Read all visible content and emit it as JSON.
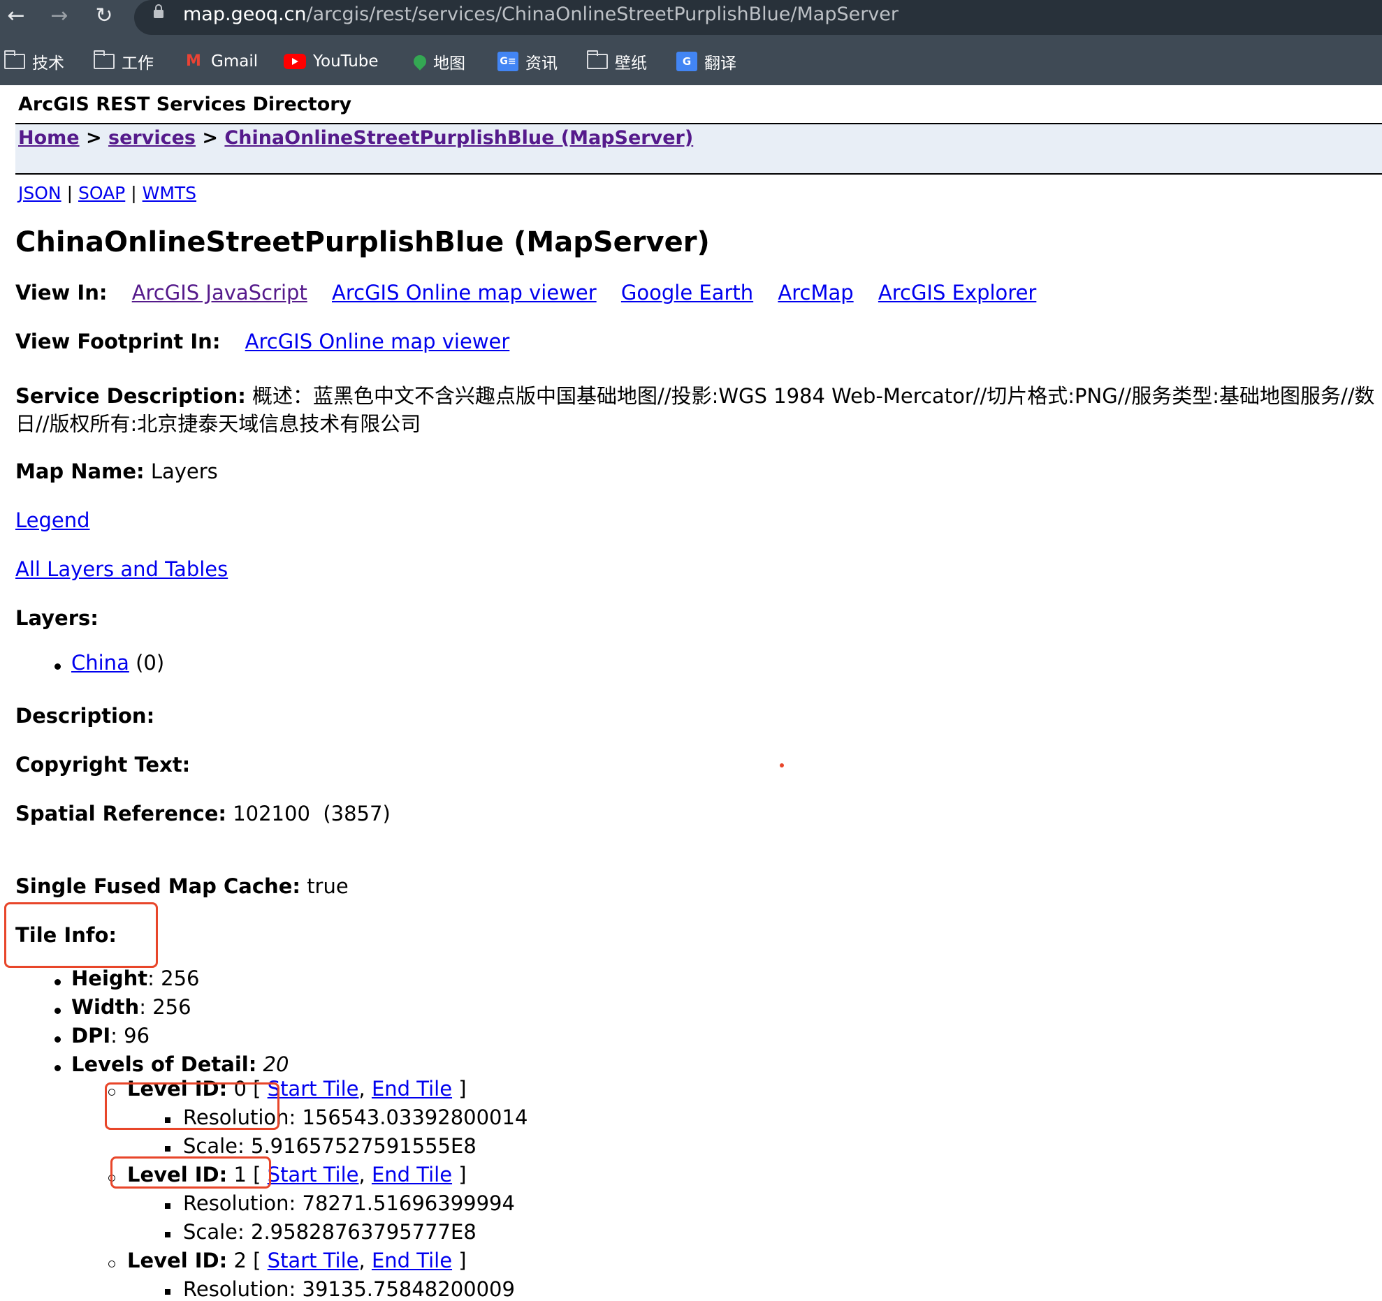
{
  "browser": {
    "url_host": "map.geoq.cn",
    "url_path": "/arcgis/rest/services/ChinaOnlineStreetPurplishBlue/MapServer",
    "bookmarks": [
      "技术",
      "工作",
      "Gmail",
      "YouTube",
      "地图",
      "资讯",
      "壁纸",
      "翻译"
    ]
  },
  "header": {
    "title": "ArcGIS REST Services Directory",
    "breadcrumb": [
      "Home",
      "services",
      "ChinaOnlineStreetPurplishBlue (MapServer)"
    ],
    "breadcrumb_sep": ">",
    "formats": [
      "JSON",
      "SOAP",
      "WMTS"
    ],
    "format_sep": "|"
  },
  "service": {
    "heading": "ChinaOnlineStreetPurplishBlue (MapServer)",
    "view_in_label": "View In:",
    "view_in_links": [
      "ArcGIS JavaScript",
      "ArcGIS Online map viewer",
      "Google Earth",
      "ArcMap",
      "ArcGIS Explorer"
    ],
    "footprint_label": "View Footprint In:",
    "footprint_link": "ArcGIS Online map viewer",
    "desc_label": "Service Description:",
    "desc_line1": "概述：蓝黑色中文不含兴趣点版中国基础地图//投影:WGS 1984 Web-Mercator//切片格式:PNG//服务类型:基础地图服务//数",
    "desc_line2": "日//版权所有:北京捷泰天域信息技术有限公司",
    "map_name_label": "Map Name:",
    "map_name": "Layers",
    "legend_link": "Legend",
    "all_layers_link": "All Layers and Tables",
    "layers_label": "Layers:",
    "layer_name": "China",
    "layer_id": "(0)",
    "description_label": "Description:",
    "copyright_label": "Copyright Text:",
    "spatial_label": "Spatial Reference:",
    "spatial_value": "102100  (3857)",
    "cache_label": "Single Fused Map Cache:",
    "cache_value": "true",
    "tile_info_label": "Tile Info:"
  },
  "tile_info": {
    "height_label": "Height",
    "height_value": ": 256",
    "width_label": "Width",
    "width_value": ": 256",
    "dpi_label": "DPI",
    "dpi_value": ": 96",
    "lod_label": "Levels of Detail:",
    "lod_value": "20",
    "level_label": "Level ID:",
    "open_bracket": "[",
    "close_bracket": "]",
    "start_tile": "Start Tile",
    "end_tile": "End Tile",
    "comma": ",",
    "resolution_label": "Resolution:",
    "scale_label": "Scale:",
    "levels": [
      {
        "id": "0",
        "resolution": "156543.03392800014",
        "scale": "5.91657527591555E8"
      },
      {
        "id": "1",
        "resolution": "78271.51696399994",
        "scale": "2.95828763795777E8"
      },
      {
        "id": "2",
        "resolution": "39135.75848200009"
      }
    ]
  },
  "colors": {
    "chrome_bg": "#3f4a55",
    "link": "#0000ee",
    "visited_link": "#551a8b",
    "breadcrumb_bg": "#e8eef6",
    "annotation": "#e8462a"
  }
}
